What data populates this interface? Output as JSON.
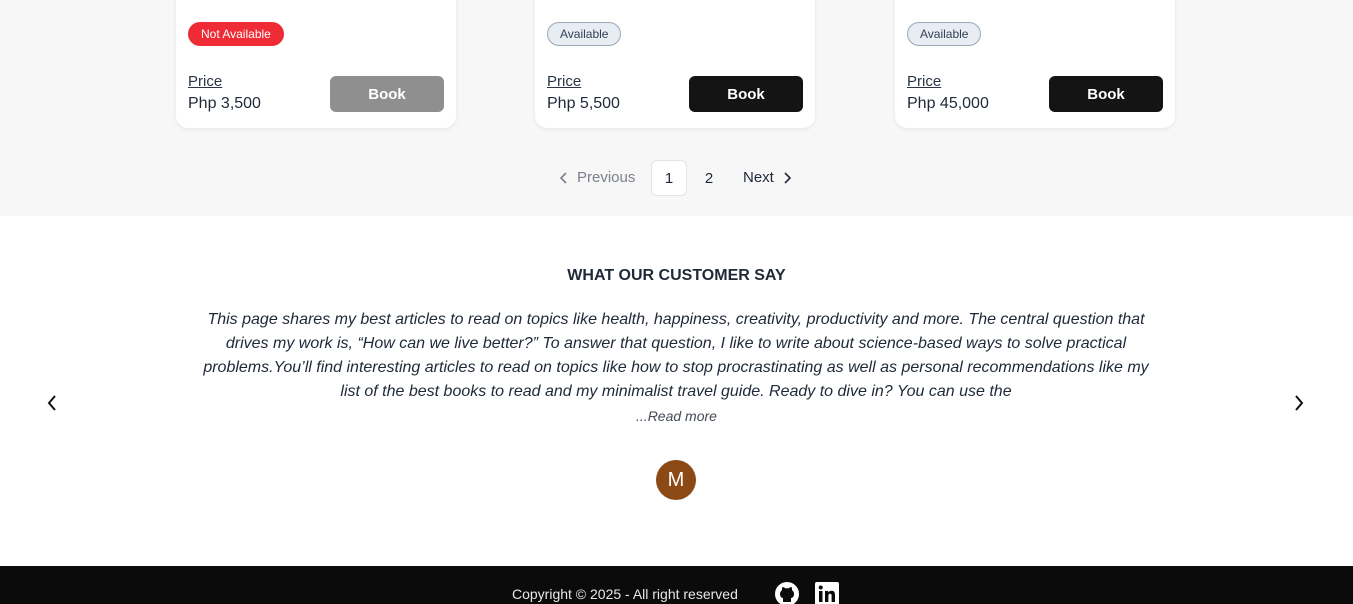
{
  "rooms": [
    {
      "status": "Not Available",
      "available": false,
      "price_label": "Price",
      "price": "Php 3,500",
      "book_label": "Book"
    },
    {
      "status": "Available",
      "available": true,
      "price_label": "Price",
      "price": "Php 5,500",
      "book_label": "Book"
    },
    {
      "status": "Available",
      "available": true,
      "price_label": "Price",
      "price": "Php 45,000",
      "book_label": "Book"
    }
  ],
  "pagination": {
    "previous_label": "Previous",
    "next_label": "Next",
    "pages": [
      "1",
      "2"
    ],
    "current_page": "1"
  },
  "testimonials": {
    "title": "WHAT OUR CUSTOMER SAY",
    "quote": "This page shares my best articles to read on topics like health, happiness, creativity, productivity and more. The central question that drives my work is, “How can we live better?” To answer that question, I like to write about science-based ways to solve practical problems.You’ll find interesting articles to read on topics like how to stop procrastinating as well as personal recommendations like my list of the best books to read and my minimalist travel guide. Ready to dive in? You can use the",
    "read_more": "...Read more",
    "avatar_initial": "M",
    "avatar_color": "#8b4a15"
  },
  "footer": {
    "copyright": "Copyright © 2025 - All right reserved",
    "icons": [
      "github-icon",
      "linkedin-icon"
    ]
  },
  "colors": {
    "not_available_badge": "#ef2b35",
    "book_button": "#141414",
    "book_button_disabled": "#8f8f8f",
    "footer_bg": "#0b0b0b"
  }
}
